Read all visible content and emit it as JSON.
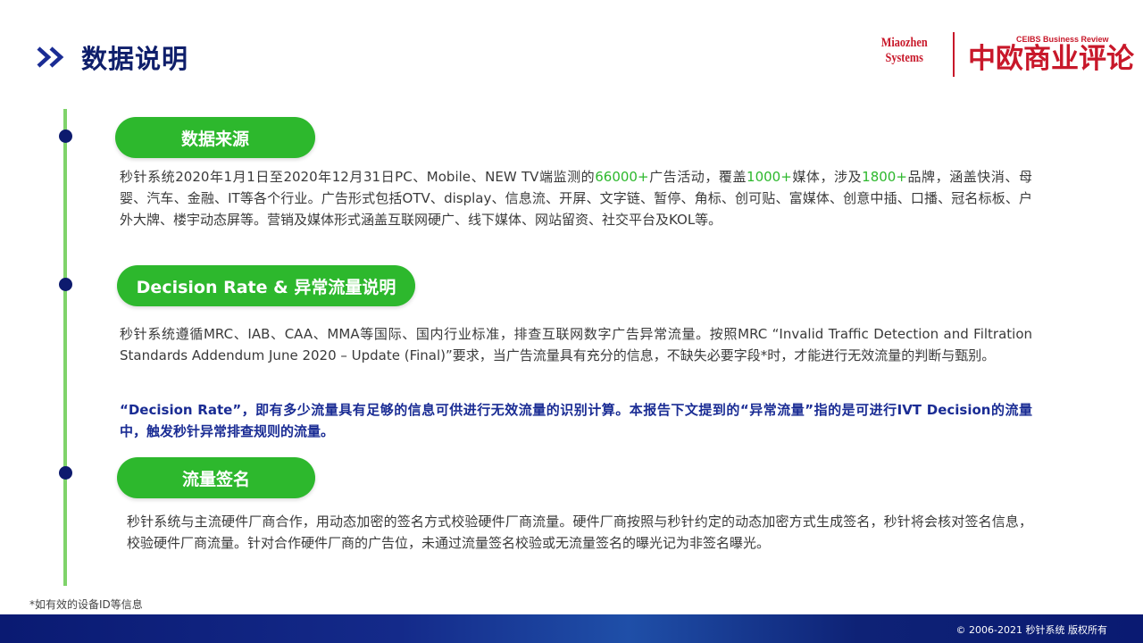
{
  "header": {
    "title": "数据说明"
  },
  "logos": {
    "miaozhen_line1": "Miaozhen",
    "miaozhen_line2": "Systems",
    "ceibs_en": "CEIBS Business Review",
    "ceibs_cn": "中欧商业评论"
  },
  "sections": [
    {
      "title": "数据来源",
      "paragraph": {
        "t1": "秒针系统2020年1月1日至2020年12月31日PC、Mobile、NEW  TV端监测的",
        "h1": "66000+",
        "t2": "广告活动，覆盖",
        "h2": "1000+",
        "t3": "媒体，涉及",
        "h3": "1800+",
        "t4": "品牌，涵盖快消、母婴、汽车、金融、IT等各个行业。广告形式包括OTV、display、信息流、开屏、文字链、暂停、角标、创可贴、富媒体、创意中插、口播、冠名标板、户外大牌、楼宇动态屏等。营销及媒体形式涵盖互联网硬广、线下媒体、网站留资、社交平台及KOL等。"
      }
    },
    {
      "title": "Decision Rate & 异常流量说明",
      "paragraph": "秒针系统遵循MRC、IAB、CAA、MMA等国际、国内行业标准，排查互联网数字广告异常流量。按照MRC  “Invalid Traffic Detection and Filtration Standards Addendum June 2020 – Update (Final)”要求，当广告流量具有充分的信息，不缺失必要字段*时，才能进行无效流量的判断与甄别。",
      "emphasis": "“Decision  Rate”，即有多少流量具有足够的信息可供进行无效流量的识别计算。本报告下文提到的“异常流量”指的是可进行IVT  Decision的流量中，触发秒针异常排查规则的流量。"
    },
    {
      "title": "流量签名",
      "paragraph": "秒针系统与主流硬件厂商合作，用动态加密的签名方式校验硬件厂商流量。硬件厂商按照与秒针约定的动态加密方式生成签名，秒针将会核对签名信息，校验硬件厂商流量。针对合作硬件厂商的广告位，未通过流量签名校验或无流量签名的曝光记为非签名曝光。"
    }
  ],
  "footnote": "*如有效的设备ID等信息",
  "footer": {
    "copyright": "© 2006-2021 秒针系统 版权所有"
  },
  "colors": {
    "accent_green": "#2db82d",
    "navy": "#0f1f6b",
    "emphasis_blue": "#1a2c94",
    "brand_red": "#c8182a"
  }
}
